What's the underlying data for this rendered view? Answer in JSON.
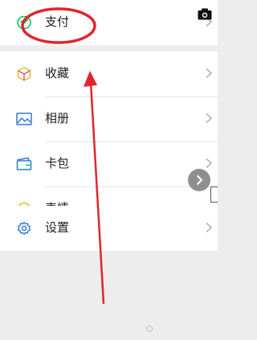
{
  "menu": {
    "group1": [
      {
        "key": "pay",
        "label": "支付",
        "icon": "pay-icon"
      }
    ],
    "group2": [
      {
        "key": "favorites",
        "label": "收藏",
        "icon": "cube-icon"
      },
      {
        "key": "album",
        "label": "相册",
        "icon": "image-icon"
      },
      {
        "key": "cards",
        "label": "卡包",
        "icon": "wallet-icon"
      },
      {
        "key": "stickers",
        "label": "表情",
        "icon": "smiley-icon"
      }
    ],
    "group3": [
      {
        "key": "settings",
        "label": "设置",
        "icon": "gear-icon"
      }
    ]
  },
  "colors": {
    "background": "#ededed",
    "card": "#ffffff",
    "annotation_red": "#e0262b",
    "icon_green": "#07c160",
    "icon_blue": "#2b7bd8",
    "icon_yellow": "#f2b230"
  },
  "icons": {
    "top_right": "camera-icon",
    "floating": "chevron-right-icon"
  }
}
